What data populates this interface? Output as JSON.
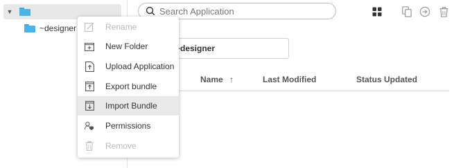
{
  "sidebar": {
    "root": {
      "label": ""
    },
    "child": {
      "label": "~designer"
    }
  },
  "search": {
    "placeholder": "Search Application"
  },
  "toolbar": {
    "icons": [
      "grid-view-icon",
      "copy-icon",
      "move-icon",
      "trash-icon"
    ]
  },
  "app_search": {
    "value": "~designer"
  },
  "table": {
    "columns": [
      {
        "label": "Name",
        "sorted": "ascending"
      },
      {
        "label": "Last Modified"
      },
      {
        "label": "Status Updated"
      }
    ]
  },
  "context_menu": {
    "items": [
      {
        "label": "Rename",
        "icon": "rename-icon",
        "disabled": true
      },
      {
        "label": "New Folder",
        "icon": "new-folder-icon",
        "disabled": false
      },
      {
        "label": "Upload Application",
        "icon": "upload-icon",
        "disabled": false
      },
      {
        "label": "Export bundle",
        "icon": "export-icon",
        "disabled": false
      },
      {
        "label": "Import Bundle",
        "icon": "import-icon",
        "disabled": false,
        "highlighted": true
      },
      {
        "label": "Permissions",
        "icon": "permissions-icon",
        "disabled": false
      },
      {
        "label": "Remove",
        "icon": "trash-icon",
        "disabled": true
      }
    ]
  }
}
